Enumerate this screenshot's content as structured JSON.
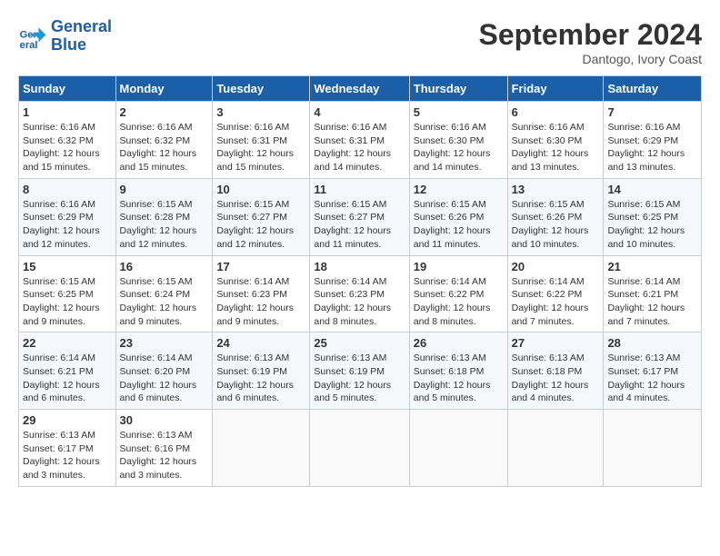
{
  "header": {
    "logo_line1": "General",
    "logo_line2": "Blue",
    "month": "September 2024",
    "location": "Dantogo, Ivory Coast"
  },
  "weekdays": [
    "Sunday",
    "Monday",
    "Tuesday",
    "Wednesday",
    "Thursday",
    "Friday",
    "Saturday"
  ],
  "weeks": [
    [
      {
        "day": "1",
        "sunrise": "6:16 AM",
        "sunset": "6:32 PM",
        "daylight": "12 hours and 15 minutes."
      },
      {
        "day": "2",
        "sunrise": "6:16 AM",
        "sunset": "6:32 PM",
        "daylight": "12 hours and 15 minutes."
      },
      {
        "day": "3",
        "sunrise": "6:16 AM",
        "sunset": "6:31 PM",
        "daylight": "12 hours and 15 minutes."
      },
      {
        "day": "4",
        "sunrise": "6:16 AM",
        "sunset": "6:31 PM",
        "daylight": "12 hours and 14 minutes."
      },
      {
        "day": "5",
        "sunrise": "6:16 AM",
        "sunset": "6:30 PM",
        "daylight": "12 hours and 14 minutes."
      },
      {
        "day": "6",
        "sunrise": "6:16 AM",
        "sunset": "6:30 PM",
        "daylight": "12 hours and 13 minutes."
      },
      {
        "day": "7",
        "sunrise": "6:16 AM",
        "sunset": "6:29 PM",
        "daylight": "12 hours and 13 minutes."
      }
    ],
    [
      {
        "day": "8",
        "sunrise": "6:16 AM",
        "sunset": "6:29 PM",
        "daylight": "12 hours and 12 minutes."
      },
      {
        "day": "9",
        "sunrise": "6:15 AM",
        "sunset": "6:28 PM",
        "daylight": "12 hours and 12 minutes."
      },
      {
        "day": "10",
        "sunrise": "6:15 AM",
        "sunset": "6:27 PM",
        "daylight": "12 hours and 12 minutes."
      },
      {
        "day": "11",
        "sunrise": "6:15 AM",
        "sunset": "6:27 PM",
        "daylight": "12 hours and 11 minutes."
      },
      {
        "day": "12",
        "sunrise": "6:15 AM",
        "sunset": "6:26 PM",
        "daylight": "12 hours and 11 minutes."
      },
      {
        "day": "13",
        "sunrise": "6:15 AM",
        "sunset": "6:26 PM",
        "daylight": "12 hours and 10 minutes."
      },
      {
        "day": "14",
        "sunrise": "6:15 AM",
        "sunset": "6:25 PM",
        "daylight": "12 hours and 10 minutes."
      }
    ],
    [
      {
        "day": "15",
        "sunrise": "6:15 AM",
        "sunset": "6:25 PM",
        "daylight": "12 hours and 9 minutes."
      },
      {
        "day": "16",
        "sunrise": "6:15 AM",
        "sunset": "6:24 PM",
        "daylight": "12 hours and 9 minutes."
      },
      {
        "day": "17",
        "sunrise": "6:14 AM",
        "sunset": "6:23 PM",
        "daylight": "12 hours and 9 minutes."
      },
      {
        "day": "18",
        "sunrise": "6:14 AM",
        "sunset": "6:23 PM",
        "daylight": "12 hours and 8 minutes."
      },
      {
        "day": "19",
        "sunrise": "6:14 AM",
        "sunset": "6:22 PM",
        "daylight": "12 hours and 8 minutes."
      },
      {
        "day": "20",
        "sunrise": "6:14 AM",
        "sunset": "6:22 PM",
        "daylight": "12 hours and 7 minutes."
      },
      {
        "day": "21",
        "sunrise": "6:14 AM",
        "sunset": "6:21 PM",
        "daylight": "12 hours and 7 minutes."
      }
    ],
    [
      {
        "day": "22",
        "sunrise": "6:14 AM",
        "sunset": "6:21 PM",
        "daylight": "12 hours and 6 minutes."
      },
      {
        "day": "23",
        "sunrise": "6:14 AM",
        "sunset": "6:20 PM",
        "daylight": "12 hours and 6 minutes."
      },
      {
        "day": "24",
        "sunrise": "6:13 AM",
        "sunset": "6:19 PM",
        "daylight": "12 hours and 6 minutes."
      },
      {
        "day": "25",
        "sunrise": "6:13 AM",
        "sunset": "6:19 PM",
        "daylight": "12 hours and 5 minutes."
      },
      {
        "day": "26",
        "sunrise": "6:13 AM",
        "sunset": "6:18 PM",
        "daylight": "12 hours and 5 minutes."
      },
      {
        "day": "27",
        "sunrise": "6:13 AM",
        "sunset": "6:18 PM",
        "daylight": "12 hours and 4 minutes."
      },
      {
        "day": "28",
        "sunrise": "6:13 AM",
        "sunset": "6:17 PM",
        "daylight": "12 hours and 4 minutes."
      }
    ],
    [
      {
        "day": "29",
        "sunrise": "6:13 AM",
        "sunset": "6:17 PM",
        "daylight": "12 hours and 3 minutes."
      },
      {
        "day": "30",
        "sunrise": "6:13 AM",
        "sunset": "6:16 PM",
        "daylight": "12 hours and 3 minutes."
      },
      null,
      null,
      null,
      null,
      null
    ]
  ]
}
